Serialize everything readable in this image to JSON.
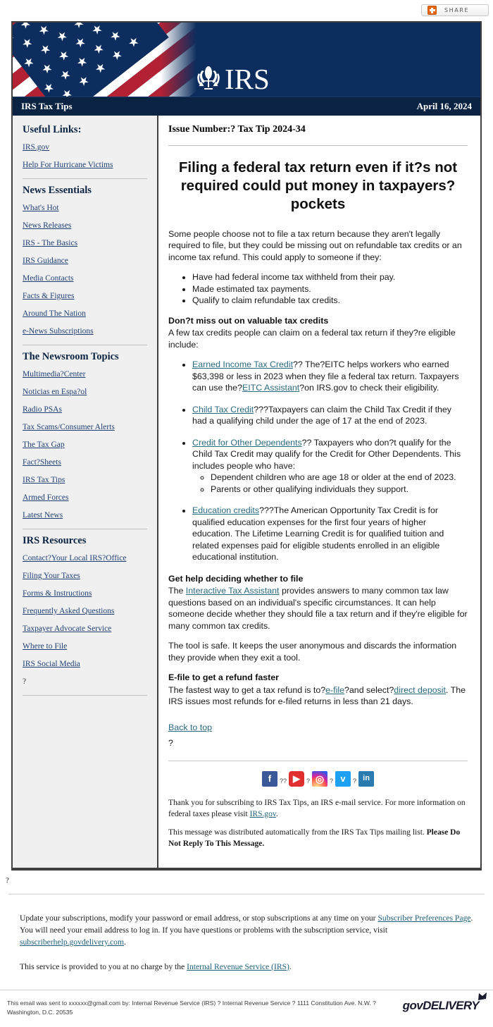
{
  "share": {
    "label": "SHARE",
    "icon": "plus-share-icon"
  },
  "masthead": {
    "logo_text": "IRS",
    "flag_alt": "us-flag-banner",
    "bg_color": "#0c2d5e"
  },
  "titlebar": {
    "publication": "IRS Tax Tips",
    "date": "April 16, 2024"
  },
  "sidebar": {
    "sections": [
      {
        "heading": "Useful Links:",
        "links": [
          "IRS.gov",
          "Help For Hurricane Victims"
        ]
      },
      {
        "heading": "News Essentials",
        "links": [
          "What's Hot",
          "News Releases",
          "IRS - The Basics",
          "IRS Guidance",
          "Media Contacts",
          "Facts & Figures",
          "Around The Nation",
          "e-News Subscriptions"
        ]
      },
      {
        "heading": "The Newsroom Topics",
        "links": [
          "Multimedia?Center",
          "Noticias en Espa?ol",
          "Radio PSAs",
          "Tax Scams/Consumer Alerts",
          "The Tax Gap",
          "Fact?Sheets",
          "IRS Tax Tips",
          "Armed Forces",
          "Latest News"
        ]
      },
      {
        "heading": "IRS Resources",
        "links": [
          "Contact?Your Local IRS?Office",
          "Filing Your Taxes",
          "Forms & Instructions",
          "Frequently Asked Questions",
          "Taxpayer Advocate Service",
          "Where to File",
          "IRS Social Media"
        ],
        "trailing_text": "?"
      }
    ]
  },
  "article": {
    "issue_number": "Issue Number:? Tax Tip 2024-34",
    "headline": "Filing a federal tax return even if it?s not required could put money in taxpayers? pockets",
    "intro": "Some people choose not to file a tax return because they aren't legally required to file, but they could be missing out on refundable tax credits or an income tax refund. This could apply to someone if they:",
    "intro_bullets": [
      "Have had federal income tax withheld from their pay.",
      "Made estimated tax payments.",
      "Qualify to claim refundable tax credits."
    ],
    "credits_heading": "Don?t miss out on valuable tax credits",
    "credits_lead": "A few tax credits people can claim on a federal tax return if they?re eligible include:",
    "credits": [
      {
        "link": "Earned Income Tax Credit",
        "text_a": "?? The?EITC helps workers who earned $63,398 or less in 2023 when they file a federal tax return. Taxpayers can use the?",
        "link2": "EITC Assistant",
        "text_b": "?on IRS.gov to check their eligibility."
      },
      {
        "link": "Child Tax Credit",
        "text_a": "???Taxpayers can claim the Child Tax Credit if they had a qualifying child under the age of 17 at the end of 2023."
      },
      {
        "link": "Credit for Other Dependents",
        "text_a": "?? Taxpayers who don?t qualify for the Child Tax Credit may qualify for the Credit for Other Dependents. This includes people who have:",
        "sub_bullets": [
          "Dependent children who are age 18 or older at the end of 2023.",
          "Parents or other qualifying individuals they support."
        ]
      },
      {
        "link": "Education credits",
        "text_a": "???The American Opportunity Tax Credit is for qualified education expenses for the first four years of higher education. The Lifetime Learning Credit is for qualified tuition and related expenses paid for eligible students enrolled in an eligible educational institution."
      }
    ],
    "help_heading": "Get help deciding whether to file",
    "help_text_a": "The ",
    "help_link": "Interactive Tax Assistant",
    "help_text_b": " provides answers to many common tax law questions based on an individual's specific circumstances. It can help someone decide whether they should file a tax return and if they're eligible for many common tax credits.",
    "tool_safe": "The tool is safe. It keeps the user anonymous and discards the information they provide when they exit a tool.",
    "efile_heading": "E-file to get a refund faster",
    "efile_text_a": "The fastest way to get a tax refund is to?",
    "efile_link": "e-file",
    "efile_text_b": "?and select?",
    "efile_link2": "direct deposit",
    "efile_text_c": ". The IRS issues most refunds for e-filed returns in less than 21 days.",
    "back_to_top": "Back to top",
    "trailing_qmark": "?"
  },
  "social": {
    "items": [
      {
        "name": "facebook-icon",
        "glyph": "f",
        "color": "#3b5998"
      },
      {
        "name": "youtube-icon",
        "glyph": "▶",
        "color": "#e02f2f"
      },
      {
        "name": "instagram-icon",
        "glyph": "◎",
        "color": "#d62976"
      },
      {
        "name": "twitter-icon",
        "glyph": "ᴠ",
        "color": "#1da1f2"
      },
      {
        "name": "linkedin-icon",
        "glyph": "in",
        "color": "#2a7bb0"
      }
    ],
    "separators": [
      "??",
      "?",
      "?",
      "?"
    ]
  },
  "email_footer": {
    "thanks_a": "Thank you for subscribing to IRS Tax Tips, an IRS e-mail service. For more information on federal taxes please visit ",
    "thanks_link": "IRS.gov",
    "thanks_b": ".",
    "auto_a": "This message was distributed automatically from the IRS Tax Tips mailing list. ",
    "auto_bold": "Please Do Not Reply To This Message."
  },
  "outer_footer": {
    "qmark": "?",
    "update_a": "Update your subscriptions, modify your password or email address, or stop subscriptions at any time on your ",
    "update_link": "Subscriber Preferences Page",
    "update_b": ". You will need your email address to log in. If you have questions or problems with the subscription service, visit ",
    "update_link2": "subscriberhelp.govdelivery.com",
    "update_c": ".",
    "service_a": "This service is provided to you at no charge by the ",
    "service_link": "Internal Revenue Service (IRS)",
    "service_b": "."
  },
  "gov_bar": {
    "sent_text": "This email was sent to xxxxxx@gmail.com by: Internal Revenue Service (IRS) ? Internal Revenue Service ? 1111 Constitution Ave. N.W. ? Washington, D.C. 20535",
    "brand": "govDELIVERY"
  }
}
